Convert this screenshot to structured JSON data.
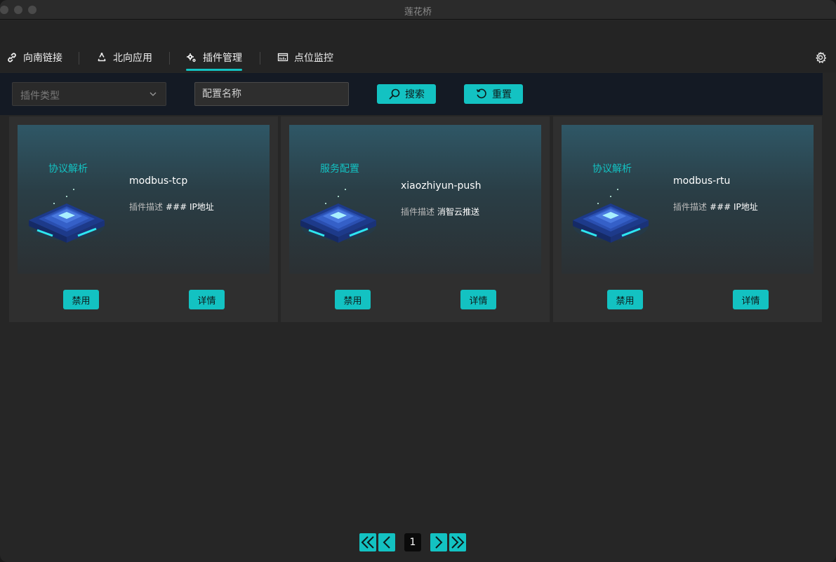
{
  "window": {
    "title": "莲花桥"
  },
  "nav": {
    "tabs": [
      {
        "label": "向南链接",
        "icon": "link-icon"
      },
      {
        "label": "北向应用",
        "icon": "recycle-icon"
      },
      {
        "label": "插件管理",
        "icon": "plugin-gear-icon",
        "active": true
      },
      {
        "label": "点位监控",
        "icon": "monitor-icon"
      }
    ],
    "settings_icon": "gear-icon"
  },
  "filters": {
    "plugin_type_placeholder": "插件类型",
    "config_name_placeholder": "配置名称",
    "search_label": "搜索",
    "reset_label": "重置"
  },
  "cards": [
    {
      "category": "协议解析",
      "name": "modbus-tcp",
      "desc_label": "插件描述",
      "desc_value": "### IP地址",
      "disable_label": "禁用",
      "detail_label": "详情"
    },
    {
      "category": "服务配置",
      "name": "xiaozhiyun-push",
      "desc_label": "插件描述",
      "desc_value": "消智云推送",
      "disable_label": "禁用",
      "detail_label": "详情"
    },
    {
      "category": "协议解析",
      "name": "modbus-rtu",
      "desc_label": "插件描述",
      "desc_value": "### IP地址",
      "disable_label": "禁用",
      "detail_label": "详情"
    }
  ],
  "pagination": {
    "current_page": "1"
  },
  "colors": {
    "accent": "#13c2c2",
    "background": "#262626",
    "filter_bar": "#141a24"
  }
}
